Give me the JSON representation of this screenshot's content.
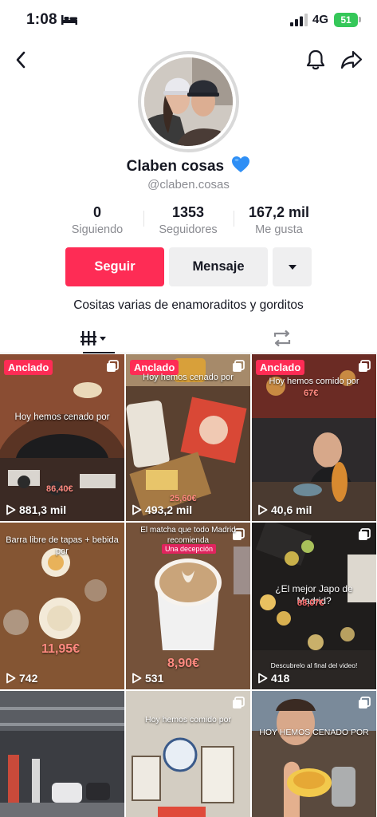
{
  "status": {
    "time": "1:08",
    "network": "4G",
    "battery": "51"
  },
  "profile": {
    "name": "Claben cosas",
    "handle": "@claben.cosas",
    "bio": "Cositas varias de enamoraditos y gorditos"
  },
  "stats": [
    {
      "value": "0",
      "label": "Siguiendo"
    },
    {
      "value": "1353",
      "label": "Seguidores"
    },
    {
      "value": "167,2 mil",
      "label": "Me gusta"
    }
  ],
  "actions": {
    "follow": "Seguir",
    "message": "Mensaje"
  },
  "colors": {
    "accent": "#fe2c55",
    "secondary_button": "#efeff0",
    "heart": "#2f8ff5",
    "battery": "#35c759"
  },
  "icons": [
    "back-icon",
    "bell-icon",
    "share-icon",
    "blue-heart-icon",
    "videos-grid-icon",
    "reposts-icon",
    "play-icon",
    "multi-photo-icon"
  ],
  "videos": [
    {
      "pinned": "Anclado",
      "caption": "Hoy hemos cenado por",
      "price": "86,40€",
      "views": "881,3 mil"
    },
    {
      "pinned": "Anclado",
      "caption": "Hoy hemos cenado por",
      "price": "25,60€",
      "views": "493,2 mil"
    },
    {
      "pinned": "Anclado",
      "caption": "Hoy hemos comido por",
      "price": "67€",
      "views": "40,6 mil"
    },
    {
      "caption": "Barra libre de tapas + bebida por",
      "price": "11,95€",
      "views": "742"
    },
    {
      "caption": "El matcha que todo Madrid recomienda",
      "tag": "Una decepción",
      "price": "8,90€",
      "views": "531"
    },
    {
      "caption": "¿El mejor Japo de Madrid?",
      "price": "88,07€",
      "extra": "Descubrelo al final del video!",
      "views": "418"
    },
    {
      "caption": ""
    },
    {
      "caption": "Hoy hemos comido por"
    },
    {
      "caption": "HOY HEMOS CENADO POR"
    }
  ]
}
